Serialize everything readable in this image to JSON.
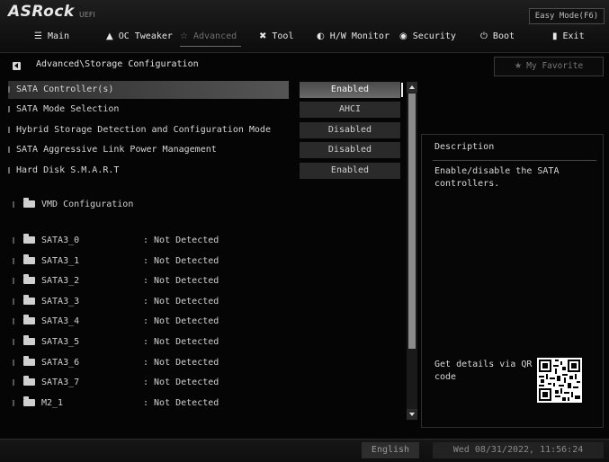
{
  "header": {
    "brand": "ASRock",
    "brand_sub": "UEFI",
    "easy_mode": "Easy Mode(F6)",
    "tabs": [
      {
        "label": "Main",
        "icon": "list-icon"
      },
      {
        "label": "OC Tweaker",
        "icon": "flame-icon"
      },
      {
        "label": "Advanced",
        "icon": "star-icon",
        "active": true
      },
      {
        "label": "Tool",
        "icon": "tools-icon"
      },
      {
        "label": "H/W Monitor",
        "icon": "monitor-icon"
      },
      {
        "label": "Security",
        "icon": "shield-icon"
      },
      {
        "label": "Boot",
        "icon": "power-icon"
      },
      {
        "label": "Exit",
        "icon": "exit-icon"
      }
    ]
  },
  "breadcrumb": "Advanced\\Storage Configuration",
  "favorite": "My Favorite",
  "settings": [
    {
      "label": "SATA Controller(s)",
      "value": "Enabled"
    },
    {
      "label": "SATA Mode Selection",
      "value": "AHCI"
    },
    {
      "label": "Hybrid Storage Detection and Configuration Mode",
      "value": "Disabled"
    },
    {
      "label": "SATA Aggressive Link Power Management",
      "value": "Disabled"
    },
    {
      "label": "Hard Disk S.M.A.R.T",
      "value": "Enabled"
    }
  ],
  "submenu": "VMD Configuration",
  "ports": [
    {
      "name": "SATA3_0",
      "status": ": Not Detected"
    },
    {
      "name": "SATA3_1",
      "status": ": Not Detected"
    },
    {
      "name": "SATA3_2",
      "status": ": Not Detected"
    },
    {
      "name": "SATA3_3",
      "status": ": Not Detected"
    },
    {
      "name": "SATA3_4",
      "status": ": Not Detected"
    },
    {
      "name": "SATA3_5",
      "status": ": Not Detected"
    },
    {
      "name": "SATA3_6",
      "status": ": Not Detected"
    },
    {
      "name": "SATA3_7",
      "status": ": Not Detected"
    },
    {
      "name": "M2_1",
      "status": ": Not Detected"
    }
  ],
  "description": {
    "title": "Description",
    "text": "Enable/disable the SATA controllers.",
    "qr_text": "Get details via QR code"
  },
  "footer": {
    "language": "English",
    "datetime": "Wed 08/31/2022, 11:56:24"
  }
}
